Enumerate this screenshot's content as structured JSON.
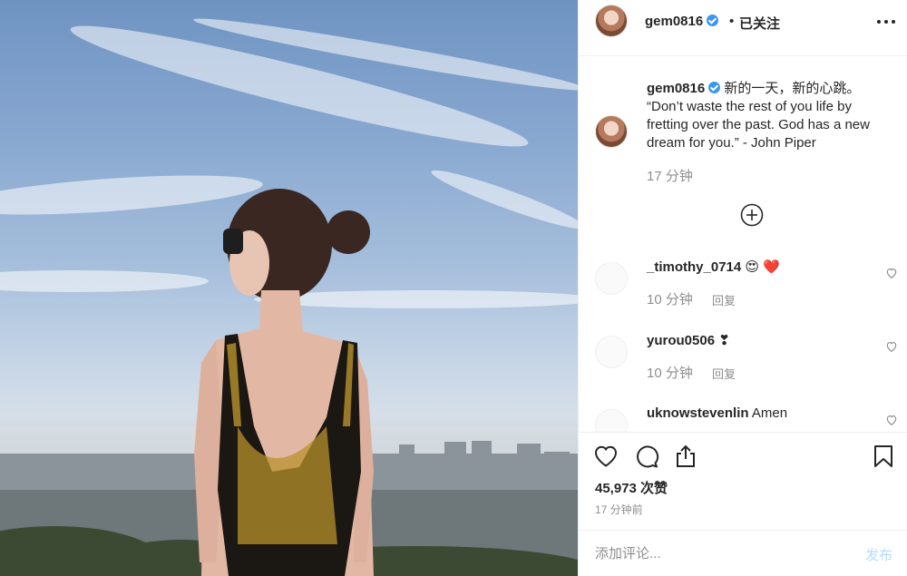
{
  "post": {
    "username": "gem0816",
    "follow_dot": "•",
    "follow_status": "已关注",
    "caption_author": "gem0816",
    "caption_text": " 新的一天，新的心跳。 “Don’t waste the rest of you life by fretting over the past. God has a new dream for you.” - John Piper",
    "caption_time": "17 分钟",
    "likes": "45,973 次赞",
    "posted_ago": "17 分钟前",
    "comment_placeholder": "添加评论...",
    "post_button": "发布"
  },
  "comments": [
    {
      "user": "_timothy_0714",
      "text": " 😍 ❤️",
      "time": "10 分钟",
      "reply": "回复"
    },
    {
      "user": "yurou0506",
      "text": " ❣",
      "time": "10 分钟",
      "reply": "回复"
    },
    {
      "user": "uknowstevenlin",
      "text": " Amen",
      "time": "",
      "reply": ""
    }
  ],
  "icons": {
    "more": "more-options-icon",
    "load_more": "plus-circle-icon",
    "like": "heart-icon",
    "comment": "comment-icon",
    "share": "share-icon",
    "save": "bookmark-icon"
  },
  "colors": {
    "verified": "#3897f0",
    "link_disabled": "#b3dbff",
    "muted": "#8e8e8e"
  }
}
